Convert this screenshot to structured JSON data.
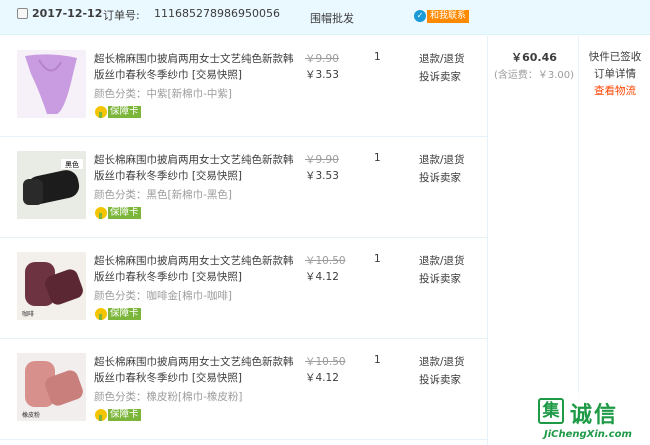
{
  "order": {
    "date": "2017-12-12",
    "order_no_label": "订单号:",
    "order_no": "111685278986950056",
    "shop_name": "围帽批发",
    "contact_label": "和我联系"
  },
  "items": [
    {
      "title": "超长棉麻围巾披肩两用女士文艺纯色新款韩版丝巾春秋冬季纱巾 [交易快照]",
      "sku": "颜色分类：中紫[新棉巾-中紫]",
      "guarantee": "保障卡",
      "price_orig": "￥9.90",
      "price_now": "￥3.53",
      "qty": "1",
      "refund": "退款/退货",
      "complain": "投诉卖家",
      "thumb_color": "#c99be0",
      "thumb_label": ""
    },
    {
      "title": "超长棉麻围巾披肩两用女士文艺纯色新款韩版丝巾春秋冬季纱巾 [交易快照]",
      "sku": "颜色分类：黑色[新棉巾-黑色]",
      "guarantee": "保障卡",
      "price_orig": "￥9.90",
      "price_now": "￥3.53",
      "qty": "1",
      "refund": "退款/退货",
      "complain": "投诉卖家",
      "thumb_color": "#1c1c1c",
      "thumb_label": "黑色"
    },
    {
      "title": "超长棉麻围巾披肩两用女士文艺纯色新款韩版丝巾春秋冬季纱巾 [交易快照]",
      "sku": "颜色分类：咖啡金[棉巾-咖啡]",
      "guarantee": "保障卡",
      "price_orig": "￥10.50",
      "price_now": "￥4.12",
      "qty": "1",
      "refund": "退款/退货",
      "complain": "投诉卖家",
      "thumb_color": "#6e3340",
      "thumb_label": "咖啡"
    },
    {
      "title": "超长棉麻围巾披肩两用女士文艺纯色新款韩版丝巾春秋冬季纱巾 [交易快照]",
      "sku": "颜色分类：橡皮粉[棉巾-橡皮粉]",
      "guarantee": "保障卡",
      "price_orig": "￥10.50",
      "price_now": "￥4.12",
      "qty": "1",
      "refund": "退款/退货",
      "complain": "投诉卖家",
      "thumb_color": "#d7908c",
      "thumb_label": "橡皮粉"
    }
  ],
  "summary": {
    "total": "￥60.46",
    "shipping": "(含运费：￥3.00)"
  },
  "status": {
    "state": "快件已签收",
    "detail": "订单详情",
    "logistics": "查看物流"
  },
  "watermark": {
    "mark": "集",
    "text": "诚信",
    "url": "JiChengXin.com"
  },
  "colors": {
    "header_bg": "#eaf8ff",
    "link_red": "#ff4400",
    "guarantee_green": "#7bb53a",
    "contact_orange": "#ff8a00"
  }
}
